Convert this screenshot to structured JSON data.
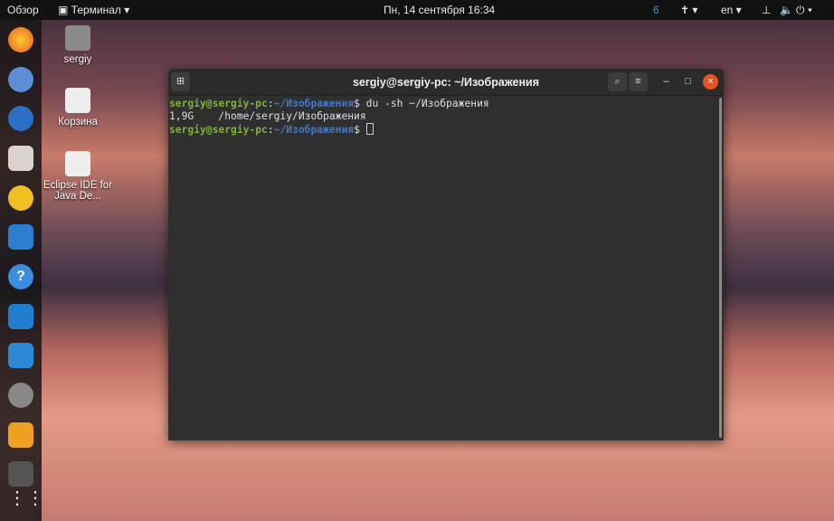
{
  "topbar": {
    "activities": "Обзор",
    "app": "Терминал ▾",
    "clock": "Пн, 14 сентября  16:34",
    "lang": "en ▾",
    "accessibility": "✝ ▾",
    "system": "⏻ ▾"
  },
  "desktop": [
    {
      "label": "sergiy"
    },
    {
      "label": "Корзина"
    },
    {
      "label": "Eclipse IDE for Java De..."
    }
  ],
  "dock": [
    "firefox",
    "chromium",
    "thunderbird",
    "files",
    "rhythmbox",
    "writer",
    "help",
    "vscode",
    "system-monitor",
    "settings",
    "app-64",
    "app",
    "show-apps"
  ],
  "window": {
    "title": "sergiy@sergiy-pc: ~/Изображения",
    "lines": [
      {
        "user": "sergiy@sergiy-pc",
        "path": "~/Изображения",
        "cmd": "$ du -sh ~/Изображения"
      },
      {
        "output": "1,9G\t/home/sergiy/Изображения"
      },
      {
        "user": "sergiy@sergiy-pc",
        "path": "~/Изображения",
        "cmd": "$ "
      }
    ]
  }
}
